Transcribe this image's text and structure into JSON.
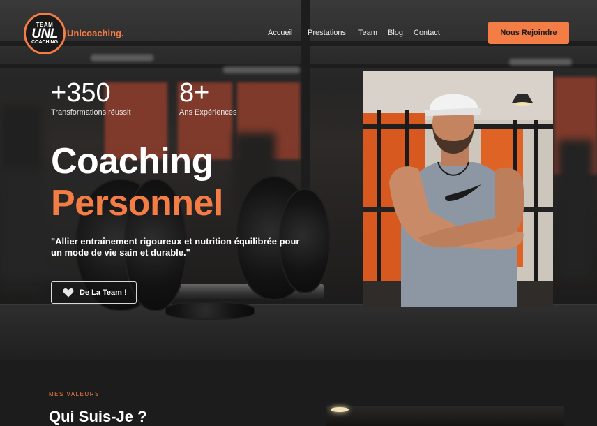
{
  "brand": {
    "logo_top": "TEAM",
    "logo_mid": "UNL",
    "logo_bottom": "COACHING",
    "name": "Unlcoaching."
  },
  "nav": {
    "items": [
      "Accueil",
      "Prestations",
      "Team",
      "Blog",
      "Contact"
    ],
    "cta": "Nous Rejoindre"
  },
  "stats": [
    {
      "value": "+350",
      "label": "Transformations réussit"
    },
    {
      "value": "8+",
      "label": "Ans Expériences"
    }
  ],
  "hero": {
    "title_line1": "Coaching",
    "title_line2": "Personnel",
    "quote": "\"Allier entraînement rigoureux et nutrition équilibrée pour un mode de vie sain et durable.\"",
    "button_label": "De La Team !"
  },
  "section2": {
    "eyebrow": "MES VALEURS",
    "title": "Qui Suis-Je ?"
  },
  "colors": {
    "accent": "#f47c45",
    "background": "#1c1c1c",
    "text": "#ffffff"
  }
}
